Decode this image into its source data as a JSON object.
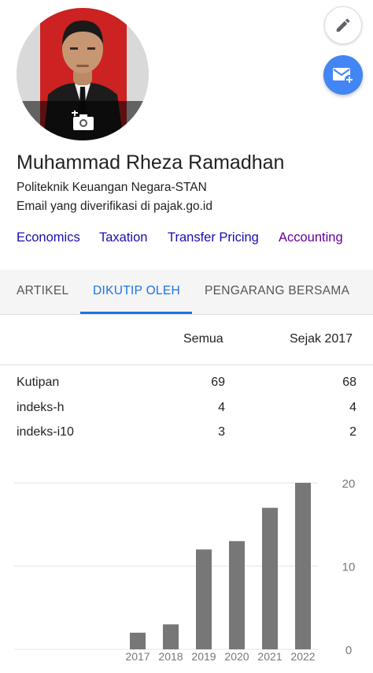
{
  "profile": {
    "name": "Muhammad Rheza Ramadhan",
    "affiliation": "Politeknik Keuangan Negara-STAN",
    "email_note": "Email yang diverifikasi di pajak.go.id",
    "interests": [
      "Economics",
      "Taxation",
      "Transfer Pricing",
      "Accounting"
    ]
  },
  "actions": {
    "edit_icon": "pencil-icon",
    "mail_icon": "add-email-icon",
    "camera_icon": "add-photo-icon"
  },
  "tabs": [
    {
      "label": "ARTIKEL",
      "active": false
    },
    {
      "label": "DIKUTIP OLEH",
      "active": true
    },
    {
      "label": "PENGARANG BERSAMA",
      "active": false
    }
  ],
  "stats": {
    "headers": [
      "Semua",
      "Sejak 2017"
    ],
    "rows": [
      {
        "label": "Kutipan",
        "all": "69",
        "since": "68"
      },
      {
        "label": "indeks-h",
        "all": "4",
        "since": "4"
      },
      {
        "label": "indeks-i10",
        "all": "3",
        "since": "2"
      }
    ]
  },
  "colors": {
    "accent": "#1a73e8",
    "link": "#1a0dab",
    "visited_link": "#660099",
    "fab_blue": "#4285f4",
    "bar": "#777777"
  },
  "chart_data": {
    "type": "bar",
    "categories": [
      "2017",
      "2018",
      "2019",
      "2020",
      "2021",
      "2022"
    ],
    "values": [
      2,
      3,
      12,
      13,
      17,
      20
    ],
    "ylim": [
      0,
      20
    ],
    "yticks": [
      "0",
      "10",
      "20"
    ],
    "grid": true
  }
}
